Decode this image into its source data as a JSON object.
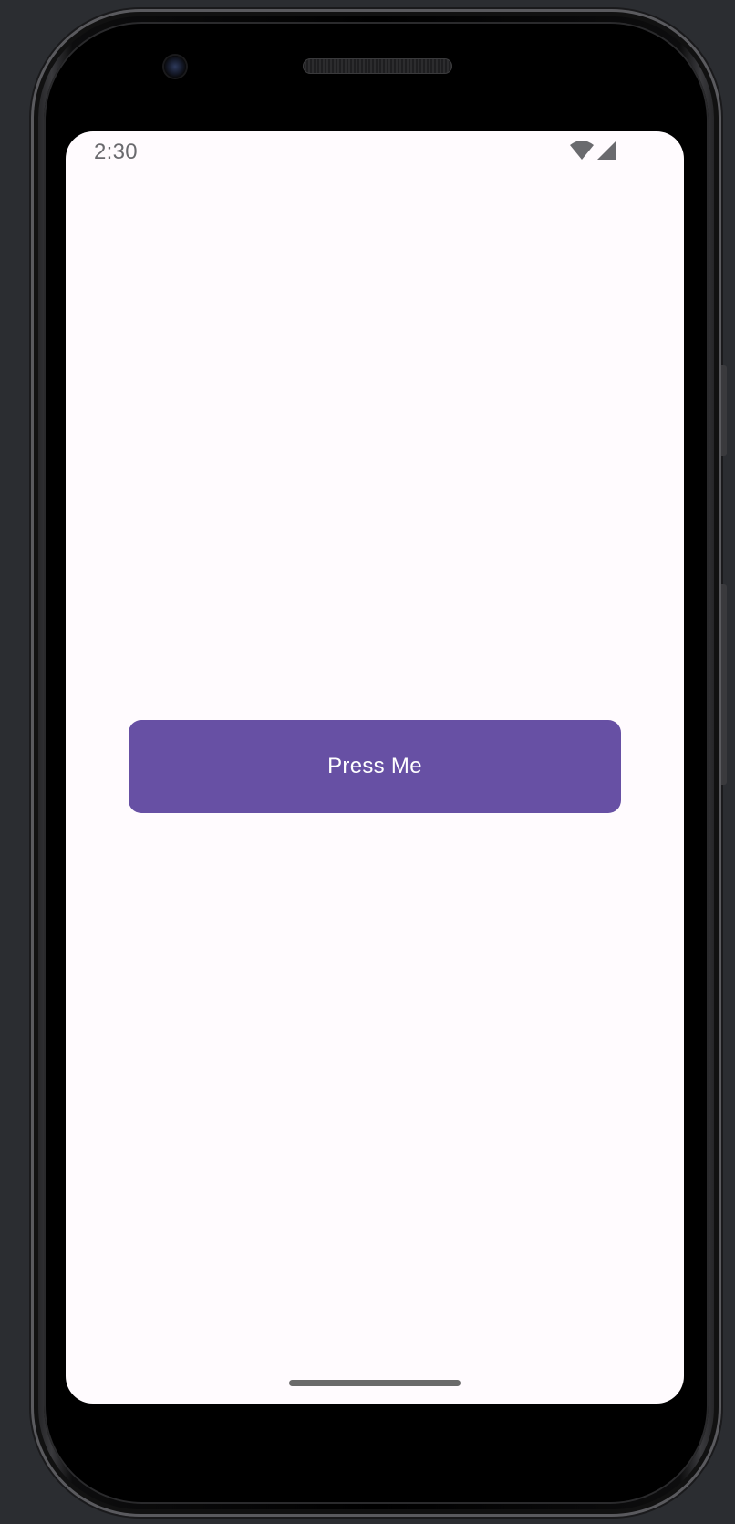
{
  "status_bar": {
    "time": "2:30",
    "icons": [
      "wifi-icon",
      "cellular-signal-icon"
    ]
  },
  "main": {
    "button_label": "Press Me"
  },
  "colors": {
    "button": "#6750a4",
    "button_text": "#ffffff",
    "screen_background": "#fffbfe",
    "status_text": "#6a6a6e"
  }
}
